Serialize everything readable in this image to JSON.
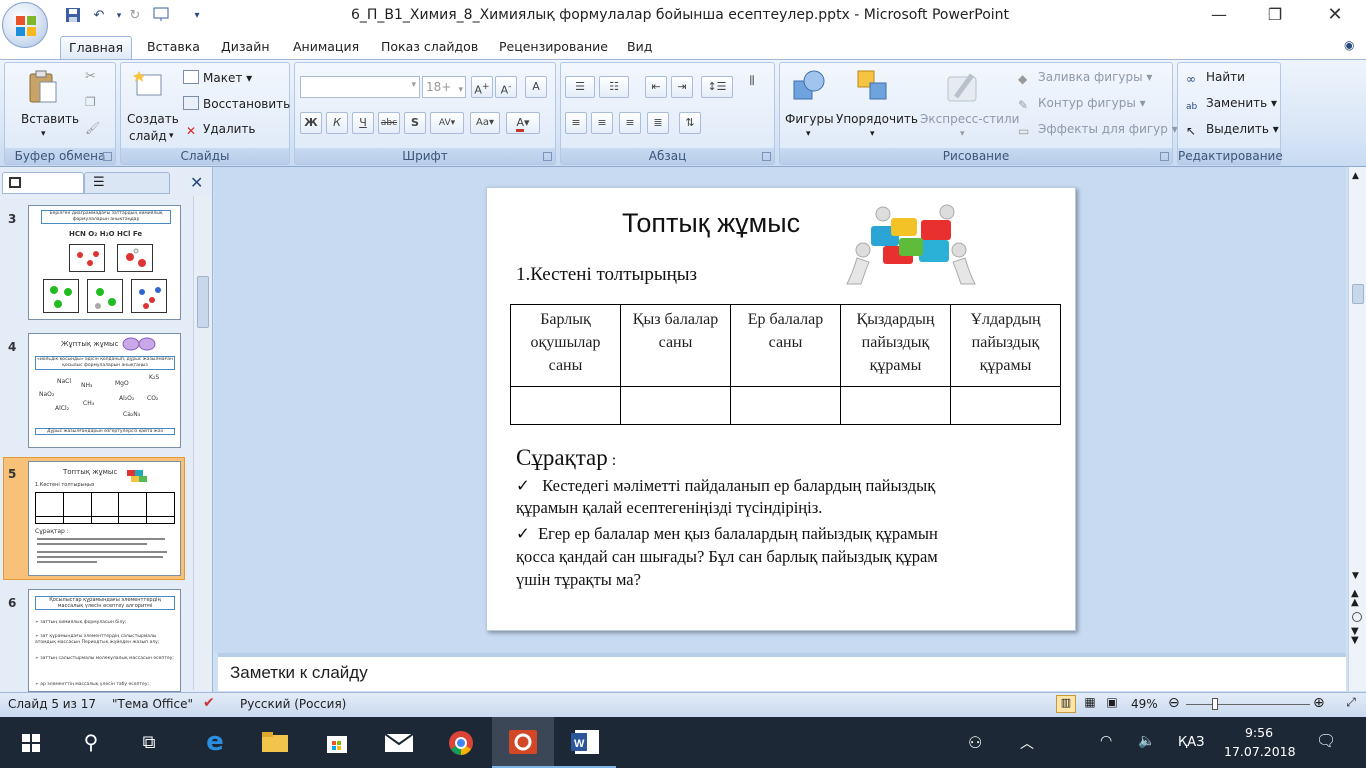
{
  "window": {
    "title": "6_П_В1_Химия_8_Химиялық формулалар бойынша есептеулер.pptx - Microsoft PowerPoint"
  },
  "tabs": [
    "Главная",
    "Вставка",
    "Дизайн",
    "Анимация",
    "Показ слайдов",
    "Рецензирование",
    "Вид"
  ],
  "ribbon": {
    "clipboard": {
      "label": "Буфер обмена",
      "paste": "Вставить"
    },
    "slides": {
      "label": "Слайды",
      "new_slide_1": "Создать",
      "new_slide_2": "слайд",
      "layout": "Макет",
      "reset": "Восстановить",
      "delete": "Удалить"
    },
    "font": {
      "label": "Шрифт",
      "font_name": "",
      "font_size": "18+"
    },
    "paragraph": {
      "label": "Абзац"
    },
    "drawing": {
      "label": "Рисование",
      "shapes": "Фигуры",
      "arrange": "Упорядочить",
      "quick_styles": "Экспресс-стили",
      "fill": "Заливка фигуры",
      "outline": "Контур фигуры",
      "effects": "Эффекты для фигур"
    },
    "editing": {
      "label": "Редактирование",
      "find": "Найти",
      "replace": "Заменить",
      "select": "Выделить"
    }
  },
  "thumbnails": {
    "s3": {
      "num": "3",
      "caption": "Берілген диаграммадағы заттардың химиялық формулаларын анықтаңдар",
      "formulas": "HCN   O₂   H₂O   HCl   Fe"
    },
    "s4": {
      "num": "4",
      "title": "Жұптық жұмыс",
      "box": "«иольдік қосынды» әдісін қолданып, дұрыс жазылмаған қосылыс формулаларын анықтаңыз",
      "f1": "NaCl",
      "f2": "NH₃",
      "f3": "MgO",
      "f4": "K₂S",
      "f5": "NaO₂",
      "f6": "CH₄",
      "f7": "Al₂O₂",
      "f8": "CO₂",
      "f9": "AlCl₂",
      "f10": "Ca₂N₃",
      "footer": "Дұрыс жазылғандарын өзгертулерсіз қайта жаз"
    },
    "s5": {
      "num": "5",
      "title": "Топтық жұмыс",
      "sub": "1.Кестені толтырыңыз",
      "q": "Сұрақтар :"
    },
    "s6": {
      "num": "6",
      "box": "Қосылыстар құрамындағы элементтердің массалық үлесін есептеу алгоритмі",
      "l1": "➢ заттың химиялық формуласын білу;",
      "l2": "➢ зат құрамындағы элементтердің салыстырмалы атомдық массасын Периодтық жүйеден жазып алу;",
      "l3": "➢ заттың салыстырмалы молекулалық массасын есептеу;",
      "l4": "➢ әр элементтің массалық үлесін табу есептеу;"
    }
  },
  "slide": {
    "title": "Топтық жұмыс",
    "subtitle": "1.Кестені толтырыңыз",
    "table_headers": [
      "Барлық оқушылар саны",
      "Қыз балалар саны",
      "Ер балалар саны",
      "Қыздардың пайыздық құрамы",
      "Ұлдардың пайыздық құрамы"
    ],
    "questions_title": "Сұрақтар",
    "questions_colon": " :",
    "q1_line1": "Кестедегі мәліметті пайдаланып ер балардың пайыздық",
    "q1_line2": "құрамын қалай  есептегеніңізді түсіндіріңіз.",
    "q2_line1": "Егер ер балалар мен қыз балалардың пайыздық құрамын",
    "q2_line2": "қосса қандай  сан шығады? Бұл сан барлық пайыздық құрам",
    "q2_line3": "үшін тұрақты ма?"
  },
  "notes": {
    "placeholder": "Заметки к слайду"
  },
  "status": {
    "slide": "Слайд 5 из 17",
    "theme": "\"Тема Office\"",
    "language": "Русский (Россия)",
    "zoom": "49%"
  },
  "tray": {
    "lang": "ҚАЗ",
    "time": "9:56",
    "date": "17.07.2018"
  }
}
